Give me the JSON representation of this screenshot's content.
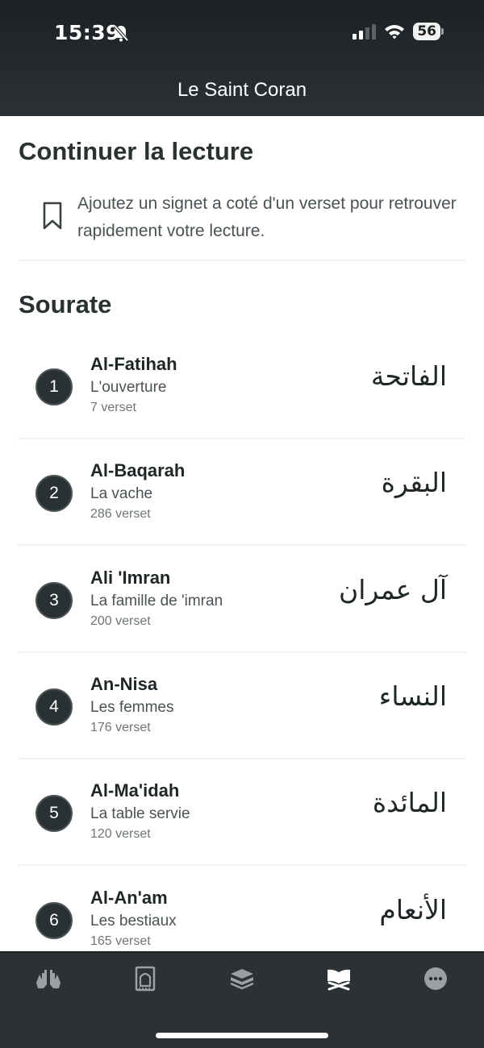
{
  "status_bar": {
    "time": "15:39",
    "battery": "56"
  },
  "header": {
    "title": "Le Saint Coran"
  },
  "continue_reading": {
    "title": "Continuer la lecture",
    "message": "Ajoutez un signet a coté d'un verset pour retrouver rapidement votre lecture."
  },
  "sourates": {
    "title": "Sourate",
    "items": [
      {
        "number": "1",
        "name": "Al-Fatihah",
        "translation": "L'ouverture",
        "verses": "7 verset",
        "arabic": "الفاتحة"
      },
      {
        "number": "2",
        "name": "Al-Baqarah",
        "translation": "La vache",
        "verses": "286 verset",
        "arabic": "البقرة"
      },
      {
        "number": "3",
        "name": "Ali 'Imran",
        "translation": "La famille de 'imran",
        "verses": "200 verset",
        "arabic": "آل عمران"
      },
      {
        "number": "4",
        "name": "An-Nisa",
        "translation": "Les femmes",
        "verses": "176 verset",
        "arabic": "النساء"
      },
      {
        "number": "5",
        "name": "Al-Ma'idah",
        "translation": "La table servie",
        "verses": "120 verset",
        "arabic": "المائدة"
      },
      {
        "number": "6",
        "name": "Al-An'am",
        "translation": "Les bestiaux",
        "verses": "165 verset",
        "arabic": "الأنعام"
      }
    ]
  },
  "tabbar": {
    "items": [
      {
        "icon": "praying-hands-icon"
      },
      {
        "icon": "prayer-mat-icon"
      },
      {
        "icon": "book-stack-icon"
      },
      {
        "icon": "quran-icon",
        "active": true
      },
      {
        "icon": "more-icon"
      }
    ]
  },
  "colors": {
    "header_bg": "#2b3134",
    "accent": "#2a3133",
    "text": "#1f2628"
  }
}
